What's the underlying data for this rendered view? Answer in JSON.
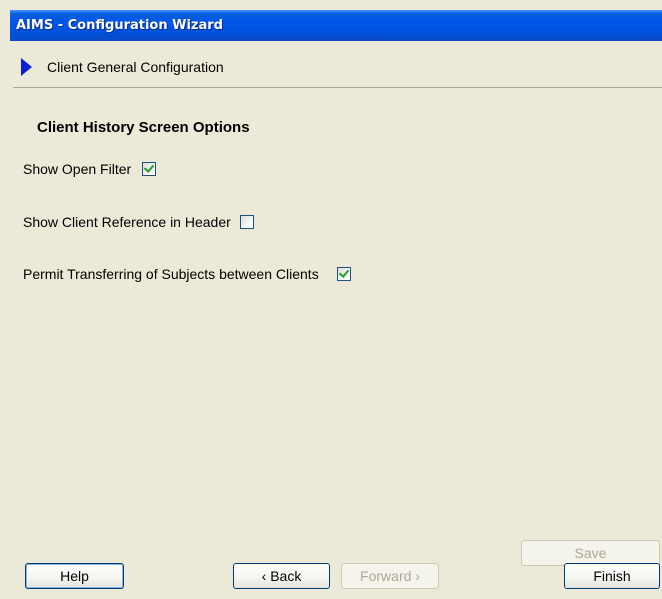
{
  "window": {
    "title": "AIMS - Configuration Wizard"
  },
  "header": {
    "title": "Client General Configuration"
  },
  "section": {
    "title": "Client History Screen Options"
  },
  "options": [
    {
      "label": "Show Open Filter",
      "checked": true
    },
    {
      "label": "Show Client Reference in Header",
      "checked": false
    },
    {
      "label": "Permit Transferring of Subjects between Clients",
      "checked": true
    }
  ],
  "buttons": {
    "save": "Save",
    "help": "Help",
    "back": "‹ Back",
    "forward": "Forward ›",
    "finish": "Finish"
  }
}
